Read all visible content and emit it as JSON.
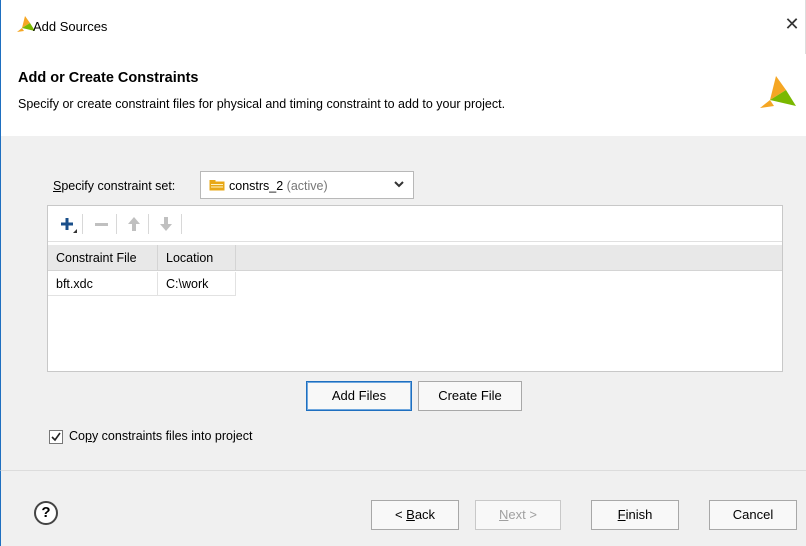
{
  "window": {
    "title": "Add Sources",
    "close_glyph": "✕"
  },
  "header": {
    "title": "Add or Create Constraints",
    "description": "Specify or create constraint files for physical and timing constraint to add to your project."
  },
  "constraint_set": {
    "label_prefix": "S",
    "label_rest": "pecify constraint set:",
    "selected_name": "constrs_2",
    "selected_suffix": " (active)"
  },
  "toolbar": {
    "icons": [
      "add-icon",
      "remove-icon",
      "move-up-icon",
      "move-down-icon"
    ]
  },
  "table": {
    "columns": [
      "Constraint File",
      "Location"
    ],
    "rows": [
      {
        "file": "bft.xdc",
        "location": "C:\\work"
      }
    ]
  },
  "buttons": {
    "add_files": "Add Files",
    "create_file": "Create File"
  },
  "copy_option": {
    "checked": true,
    "label_before": "Co",
    "label_underline": "p",
    "label_after": "y constraints files into project"
  },
  "footer": {
    "help": "?",
    "back": {
      "prefix": "< ",
      "ul": "B",
      "rest": "ack"
    },
    "next": {
      "ul": "N",
      "rest": "ext >"
    },
    "finish": {
      "ul": "F",
      "rest": "inish"
    },
    "cancel": "Cancel"
  },
  "colors": {
    "accent": "#1e6fc0",
    "logo_orange": "#f5a623",
    "logo_green": "#7ab800",
    "folder": "#e8a817"
  }
}
